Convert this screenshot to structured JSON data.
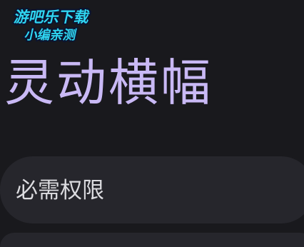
{
  "watermark": {
    "line1": "游吧乐下载",
    "line2": "小编亲测",
    "fill_color": "#2fd6f2",
    "outline_color": "#0b1430"
  },
  "page": {
    "title": "灵动横幅",
    "title_color": "#c9b9f5",
    "background_color": "#19191d"
  },
  "permissions": {
    "label": "必需权限",
    "card_color": "#26262c"
  }
}
